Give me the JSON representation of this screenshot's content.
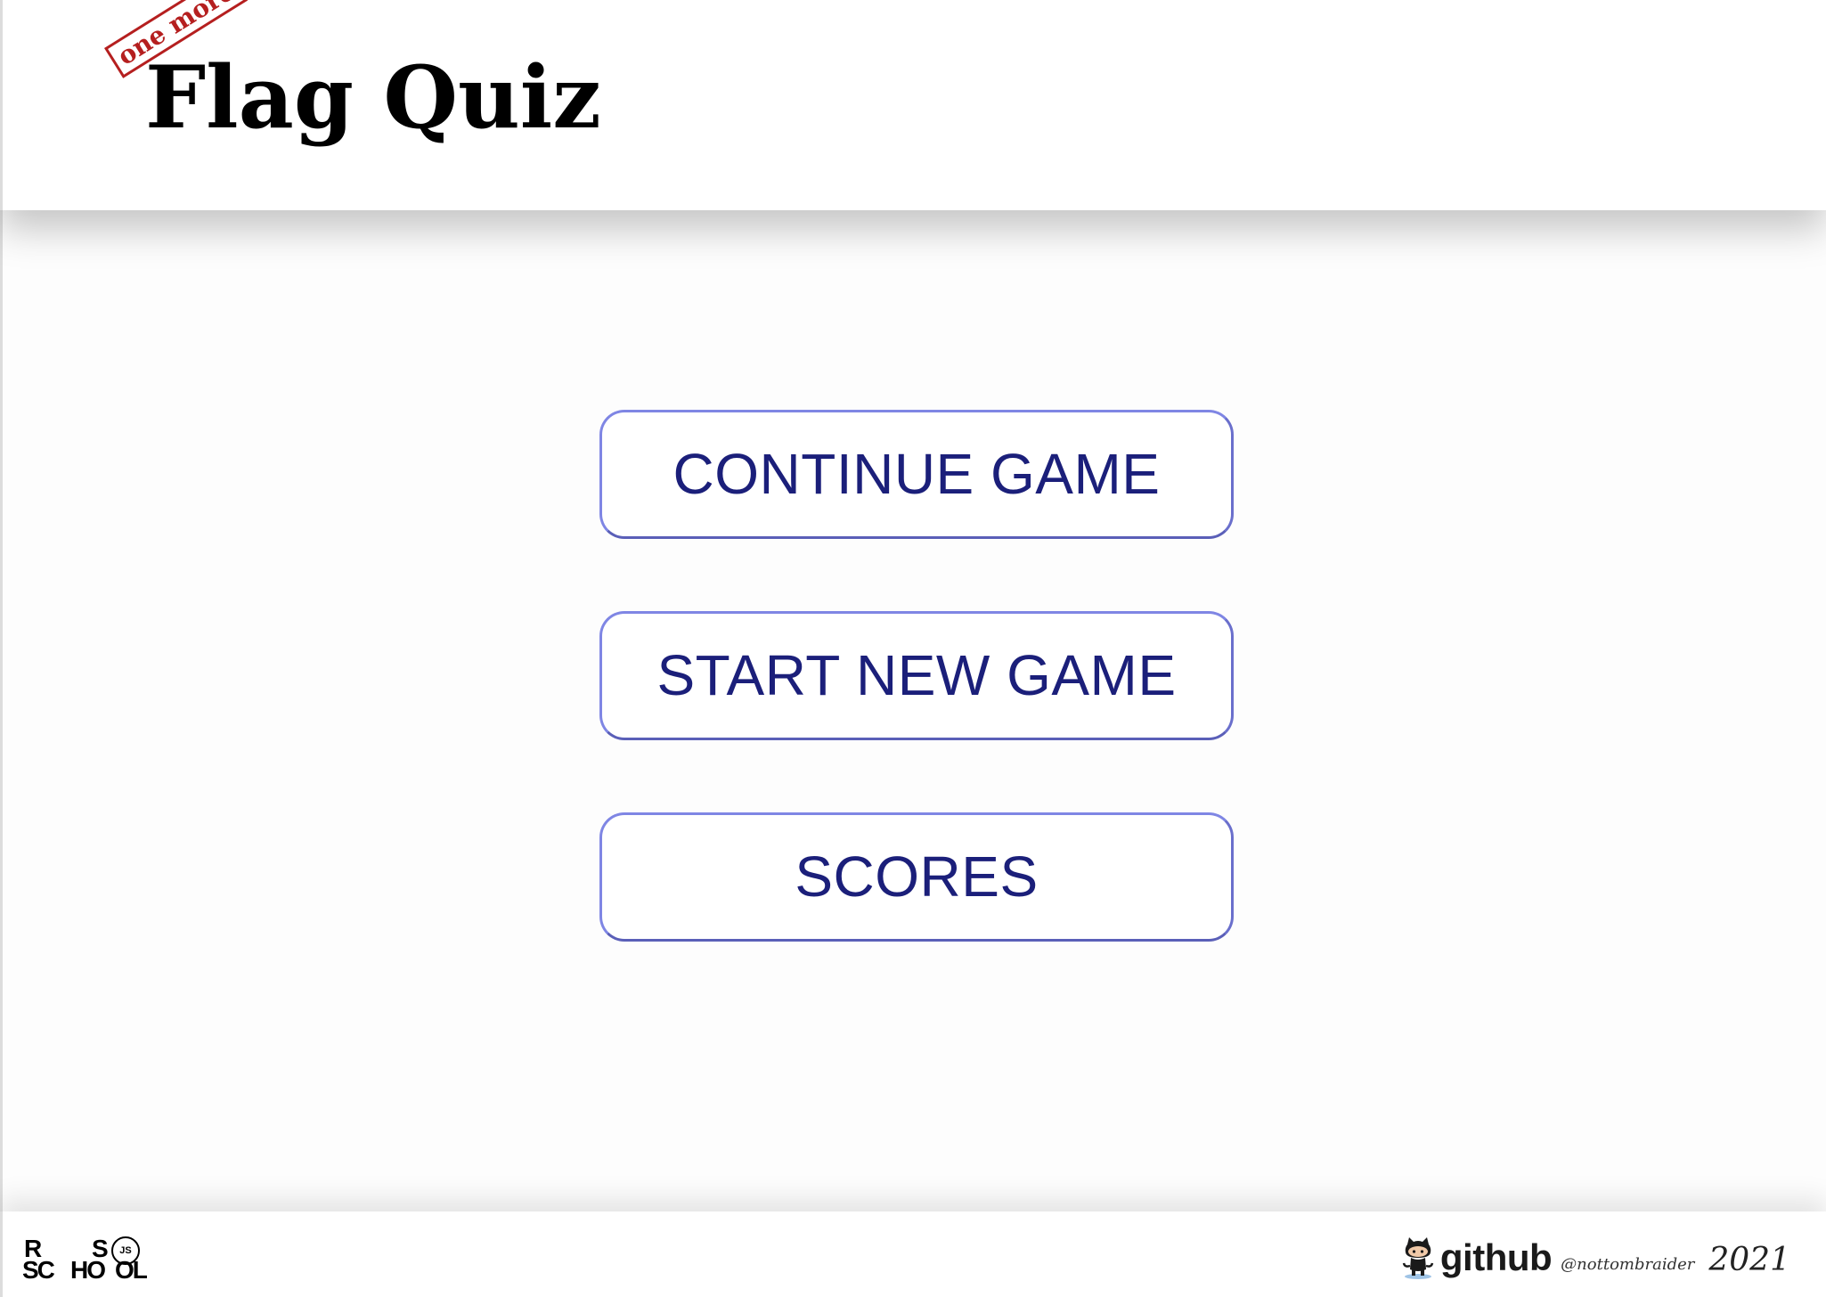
{
  "header": {
    "logo_stamp": "one more",
    "logo_title": "Flag Quiz"
  },
  "menu": {
    "buttons": [
      {
        "label": "CONTINUE GAME"
      },
      {
        "label": "START NEW GAME"
      },
      {
        "label": "SCORES"
      }
    ]
  },
  "footer": {
    "school_logo": {
      "r": "R",
      "s": "S",
      "sc": "SC",
      "ho": "HO",
      "ol": "OL",
      "js": "JS"
    },
    "github": {
      "word": "github",
      "user": "@nottombraider",
      "year": "2021",
      "icon": "octocat-icon"
    }
  },
  "colors": {
    "button_text": "#1b1f7a",
    "button_border": "#7f86e4",
    "stamp": "#b51f1f"
  }
}
